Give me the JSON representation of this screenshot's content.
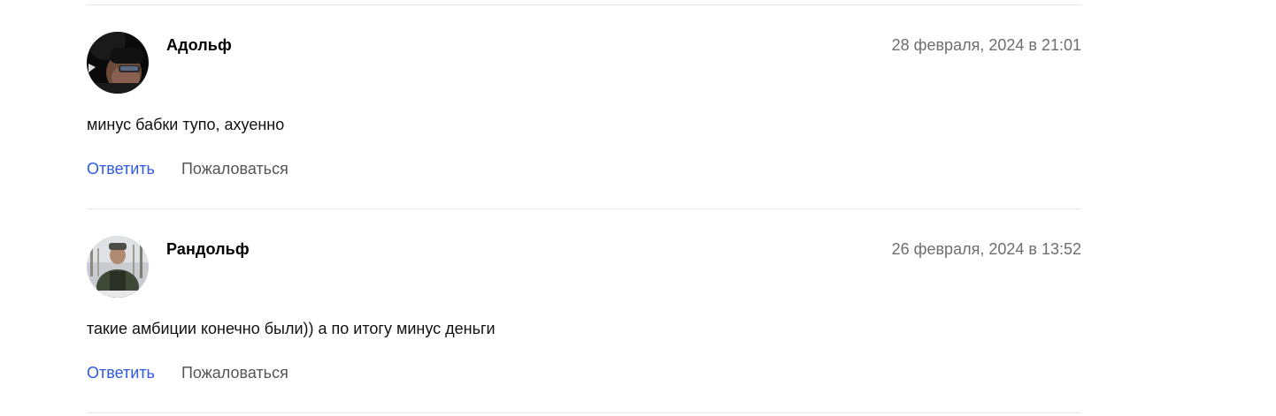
{
  "colors": {
    "reply_link": "#2f5ae4",
    "report_link": "#555555",
    "timestamp": "#6e6e6e",
    "divider": "#e6e6e6"
  },
  "comments": [
    {
      "author": "Адольф",
      "timestamp": "28 февраля, 2024 в 21:01",
      "text": "минус бабки тупо, ахуенно",
      "reply_label": "Ответить",
      "report_label": "Пожаловаться",
      "avatar_icon": "user-photo-avatar"
    },
    {
      "author": "Рандольф",
      "timestamp": "26 февраля, 2024 в 13:52",
      "text": "такие амбиции конечно были)) а по итогу минус деньги",
      "reply_label": "Ответить",
      "report_label": "Пожаловаться",
      "avatar_icon": "user-photo-avatar"
    }
  ]
}
